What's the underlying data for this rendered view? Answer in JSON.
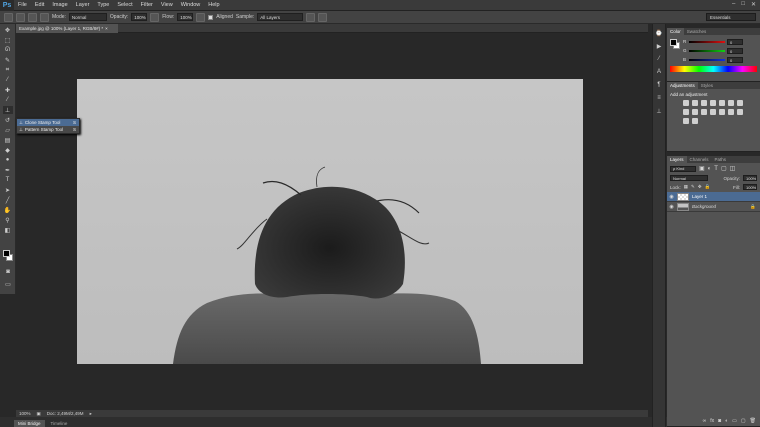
{
  "app": {
    "logo": "Ps"
  },
  "menu": [
    "File",
    "Edit",
    "Image",
    "Layer",
    "Type",
    "Select",
    "Filter",
    "View",
    "Window",
    "Help"
  ],
  "window_controls": [
    "–",
    "□",
    "✕"
  ],
  "options": {
    "mode_label": "Mode:",
    "mode_value": "Normal",
    "opacity_label": "Opacity:",
    "opacity_value": "100%",
    "flow_label": "Flow:",
    "flow_value": "100%",
    "aligned_label": "Aligned",
    "sample_label": "Sample:",
    "sample_value": "All Layers",
    "workspace": "Essentials"
  },
  "doc_tab": {
    "title": "Example.jpg @ 100% (Layer 1, RGB/8#) *",
    "close": "×"
  },
  "tool_flyout": [
    {
      "label": "Clone Stamp Tool",
      "key": "S",
      "selected": true
    },
    {
      "label": "Pattern Stamp Tool",
      "key": "S",
      "selected": false
    }
  ],
  "status": {
    "zoom": "100%",
    "doc": "Doc: 2,49M/2,49M"
  },
  "bottom_tabs": [
    "Mini Bridge",
    "Timeline"
  ],
  "color_panel": {
    "tabs": [
      "Color",
      "Swatches"
    ],
    "channels": [
      {
        "label": "R",
        "value": "0",
        "color": "#d83030"
      },
      {
        "label": "G",
        "value": "0",
        "color": "#30c030"
      },
      {
        "label": "B",
        "value": "0",
        "color": "#3060e0"
      }
    ]
  },
  "adjustments_panel": {
    "tabs": [
      "Adjustments",
      "Styles"
    ],
    "heading": "Add an adjustment"
  },
  "layers_panel": {
    "tabs": [
      "Layers",
      "Channels",
      "Paths"
    ],
    "filter": "ρ Kind",
    "blend": "Normal",
    "opacity_label": "Opacity:",
    "opacity_value": "100%",
    "lock_label": "Lock:",
    "fill_label": "Fill:",
    "fill_value": "100%",
    "layers": [
      {
        "name": "Layer 1",
        "selected": true
      },
      {
        "name": "Background",
        "selected": false
      }
    ]
  }
}
